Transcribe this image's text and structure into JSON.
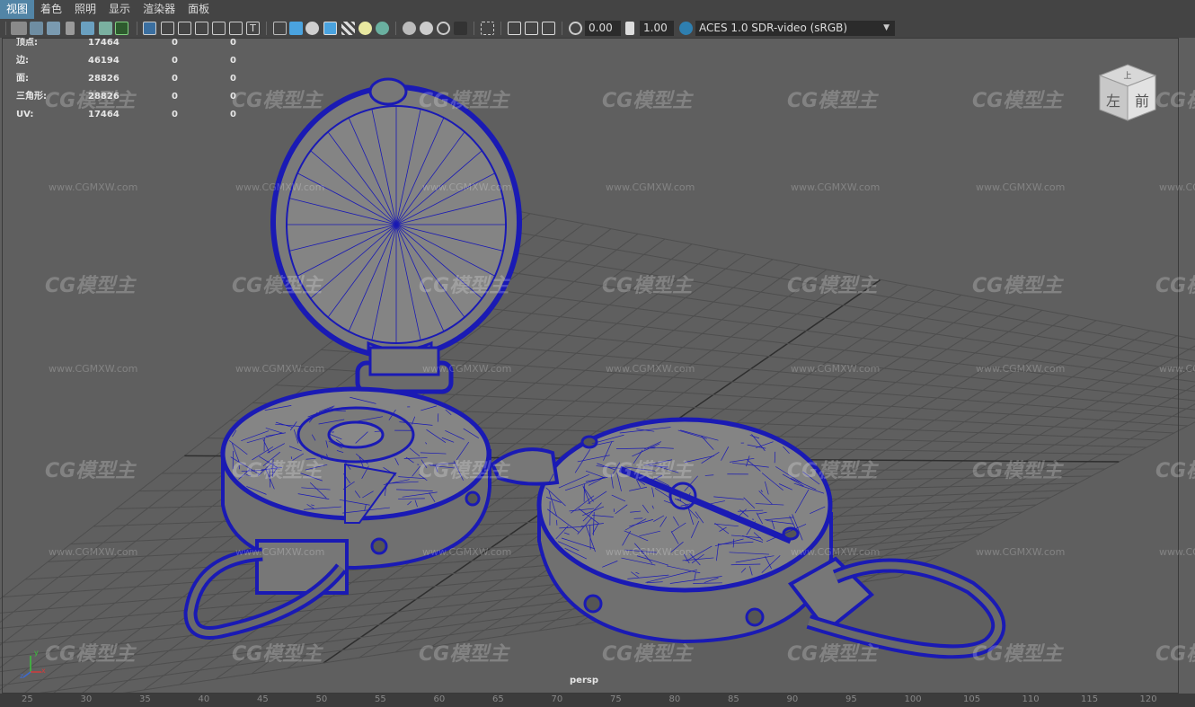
{
  "menu": {
    "items": [
      "视图",
      "着色",
      "照明",
      "显示",
      "渲染器",
      "面板"
    ],
    "active_index": 0
  },
  "toolbar": {
    "exposure_value": "0.00",
    "gamma_value": "1.00",
    "colorspace_value": "ACES 1.0 SDR-video (sRGB)",
    "icons": [
      "camera-icon",
      "camera-attr-icon",
      "bookmark-icon",
      "image-plane-icon",
      "grid-icon",
      "film-gate-icon",
      "resolution-gate-icon",
      "gate-mask-icon",
      "field-chart-icon",
      "safe-action-icon",
      "wireframe-icon",
      "smooth-shade-icon",
      "default-material-icon",
      "wireframe-on-shaded-icon",
      "textured-icon",
      "lights-icon",
      "shadows-icon",
      "ambient-occlusion-icon",
      "motion-blur-icon",
      "anti-alias-icon",
      "depth-of-field-icon",
      "isolate-select-icon",
      "xray-icon",
      "xray-joints-icon",
      "backface-icon",
      "exposure-icon",
      "gamma-icon",
      "color-management-icon"
    ]
  },
  "hud": {
    "rows": [
      {
        "label": "顶点:",
        "v1": "17464",
        "v2": "0",
        "v3": "0"
      },
      {
        "label": "边:",
        "v1": "46194",
        "v2": "0",
        "v3": "0"
      },
      {
        "label": "面:",
        "v1": "28826",
        "v2": "0",
        "v3": "0"
      },
      {
        "label": "三角形:",
        "v1": "28826",
        "v2": "0",
        "v3": "0"
      },
      {
        "label": "UV:",
        "v1": "17464",
        "v2": "0",
        "v3": "0"
      }
    ]
  },
  "viewport": {
    "camera_label": "persp",
    "viewcube": {
      "top": "上",
      "left": "左",
      "front": "前"
    },
    "axis_labels": {
      "x": "x",
      "y": "y",
      "z": "z"
    }
  },
  "watermark": {
    "logo": "CG模型主",
    "url": "www.CGMXW.com"
  },
  "ruler": {
    "ticks": [
      "25",
      "30",
      "35",
      "40",
      "45",
      "50",
      "55",
      "60",
      "65",
      "70",
      "75",
      "80",
      "85",
      "90",
      "95",
      "100",
      "105",
      "110",
      "115",
      "120"
    ]
  },
  "colors": {
    "accent": "#5285a6",
    "wire": "#1a1ab4",
    "viewport_bg": "#5f5f5f",
    "grid": "#4a4a4a",
    "grid_axis": "#2e2e2e"
  }
}
